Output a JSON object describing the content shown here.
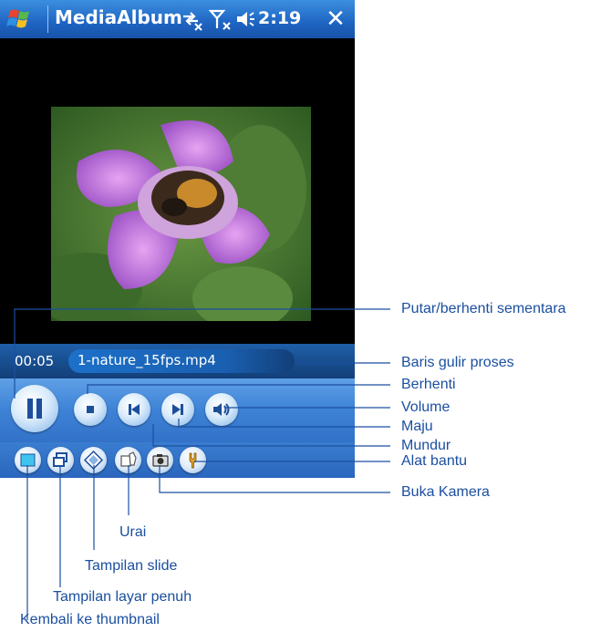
{
  "titlebar": {
    "app_title": "MediaAlbum",
    "clock": "2:19",
    "close_label": "✕",
    "icons": [
      "windows-start-icon",
      "connectivity-icon",
      "signal-off-icon",
      "volume-icon",
      "close-icon"
    ]
  },
  "player": {
    "time": "00:05",
    "file_name": "1-nature_15fps.mp4",
    "controls": [
      "pause",
      "stop",
      "previous",
      "next",
      "volume"
    ]
  },
  "toolbar": {
    "buttons": [
      "thumbnail",
      "fullscreen",
      "slideshow",
      "rotate",
      "camera",
      "tools"
    ]
  },
  "callouts": {
    "play_pause": "Putar/berhenti sementara",
    "progress_bar": "Baris gulir proses",
    "stop": "Berhenti",
    "volume": "Volume",
    "forward": "Maju",
    "backward": "Mundur",
    "tools": "Alat bantu",
    "open_camera": "Buka Kamera",
    "rotate": "Urai",
    "slideshow": "Tampilan slide",
    "fullscreen": "Tampilan layar penuh",
    "back_to_thumbnail": "Kembali ke thumbnail"
  },
  "colors": {
    "titlebar": "#1e64c2",
    "callout_text": "#1b4fa0",
    "control_bar": "#3d82d6"
  }
}
